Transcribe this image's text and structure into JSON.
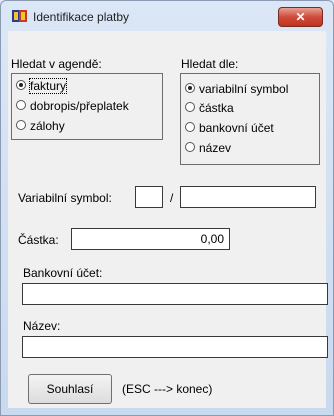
{
  "window": {
    "title": "Identifikace platby",
    "close_label": "✕"
  },
  "search_in": {
    "label": "Hledat v agendě:",
    "options": [
      {
        "label": "faktury",
        "selected": true
      },
      {
        "label": "dobropis/přeplatek",
        "selected": false
      },
      {
        "label": "zálohy",
        "selected": false
      }
    ]
  },
  "search_by": {
    "label": "Hledat dle:",
    "options": [
      {
        "label": "variabilní symbol",
        "selected": true
      },
      {
        "label": "částka",
        "selected": false
      },
      {
        "label": "bankovní účet",
        "selected": false
      },
      {
        "label": "název",
        "selected": false
      }
    ]
  },
  "form": {
    "vs_label": "Variabilní symbol:",
    "vs_separator": "/",
    "vs_prefix_value": "",
    "vs_value": "",
    "amount_label": "Částka:",
    "amount_value": "0,00",
    "bank_label": "Bankovní účet:",
    "bank_value": "",
    "name_label": "Název:",
    "name_value": ""
  },
  "actions": {
    "confirm_label": "Souhlasí",
    "hint": "(ESC ---> konec)"
  },
  "colors": {
    "close_button": "#c13220",
    "window_frame": "#c9d9ee",
    "dialog_bg": "#f0f0f0"
  }
}
